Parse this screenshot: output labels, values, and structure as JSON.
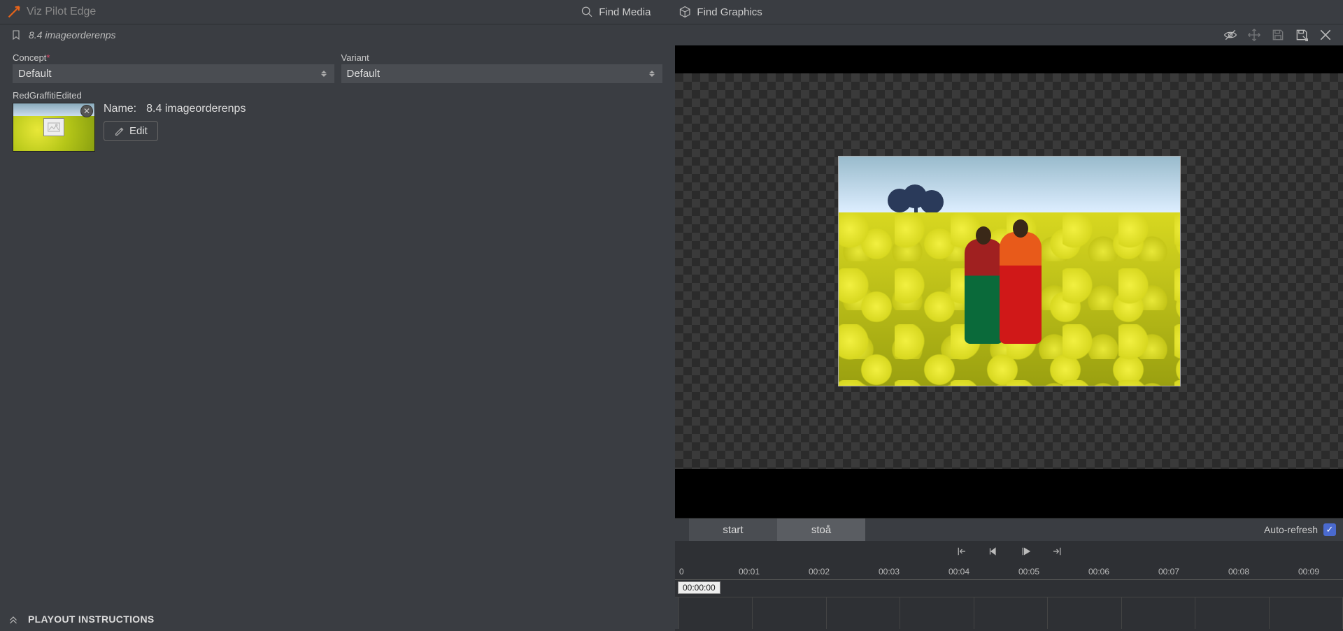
{
  "app": {
    "title": "Viz Pilot Edge"
  },
  "topnav": {
    "find_media": "Find Media",
    "find_graphics": "Find Graphics"
  },
  "breadcrumb": {
    "title": "8.4 imageorderenps"
  },
  "dropdowns": {
    "concept_label": "Concept",
    "concept_value": "Default",
    "variant_label": "Variant",
    "variant_value": "Default"
  },
  "media_item": {
    "field_label": "RedGraffitiEdited",
    "name_label": "Name:",
    "name_value": "8.4 imageorderenps",
    "edit_label": "Edit"
  },
  "playout": {
    "label": "PLAYOUT INSTRUCTIONS"
  },
  "controls": {
    "tabs": [
      "start",
      "stoå"
    ],
    "auto_refresh_label": "Auto-refresh",
    "auto_refresh_checked": true
  },
  "timeline": {
    "ticks": [
      "0",
      "00:01",
      "00:02",
      "00:03",
      "00:04",
      "00:05",
      "00:06",
      "00:07",
      "00:08",
      "00:09"
    ],
    "marker": "00:00:00",
    "cells": 9
  }
}
